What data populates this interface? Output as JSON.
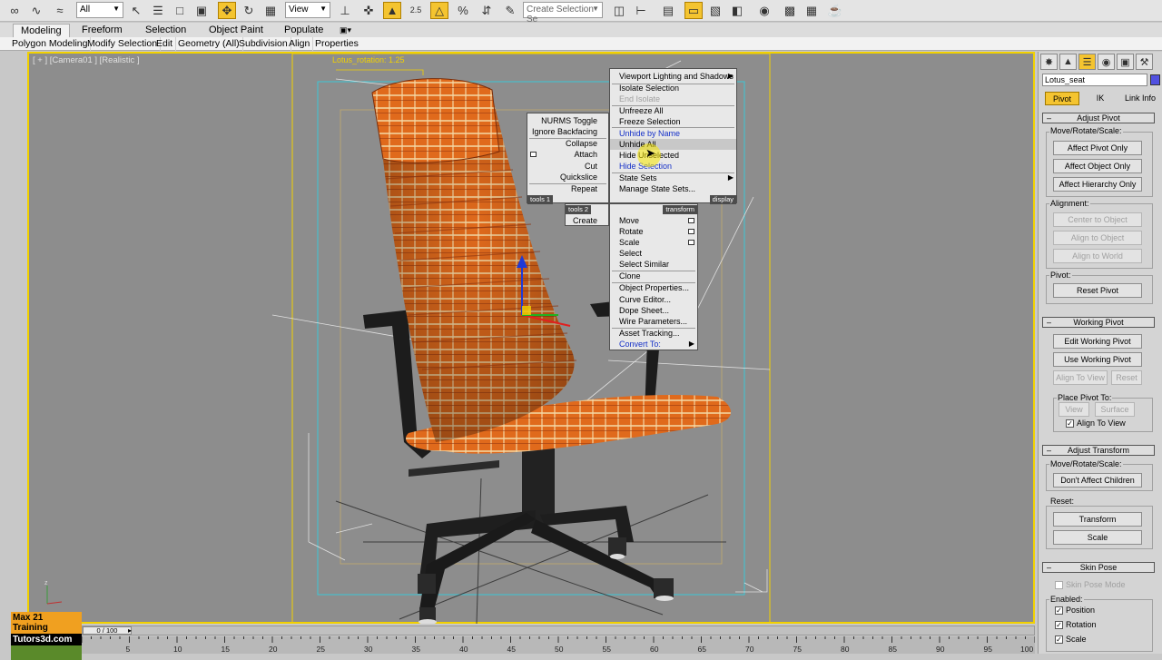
{
  "toolbar": {
    "selection_filter": "All",
    "coordinate_system": "View",
    "selection_set_placeholder": "Create Selection Se",
    "percent_label": "2.5"
  },
  "ribbon": {
    "tabs": [
      "Modeling",
      "Freeform",
      "Selection",
      "Object Paint",
      "Populate"
    ],
    "subtabs": [
      "Polygon Modeling",
      "Modify Selection",
      "Edit",
      "Geometry (All)",
      "Subdivision",
      "Align",
      "Properties"
    ]
  },
  "viewport": {
    "label": "[ + ] [Camera01 ] [Realistic ]",
    "annotation": "Lotus_rotation: 1.25",
    "accent_color": "#f2d100"
  },
  "quad_menu": {
    "display": {
      "title": "display",
      "items": [
        {
          "label": "Viewport Lighting and Shadows",
          "state": "submenu"
        },
        {
          "label": "Isolate Selection",
          "state": "normal"
        },
        {
          "label": "End Isolate",
          "state": "disabled"
        },
        {
          "label": "Unfreeze All",
          "state": "normal"
        },
        {
          "label": "Freeze Selection",
          "state": "normal"
        },
        {
          "label": "Unhide by Name",
          "state": "blue"
        },
        {
          "label": "Unhide All",
          "state": "highlight"
        },
        {
          "label": "Hide Unselected",
          "state": "normal"
        },
        {
          "label": "Hide Selection",
          "state": "blue"
        },
        {
          "label": "State Sets",
          "state": "submenu"
        },
        {
          "label": "Manage State Sets...",
          "state": "normal"
        }
      ]
    },
    "tools1": {
      "title": "tools 1",
      "items": [
        "NURMS Toggle",
        "Ignore Backfacing",
        "Collapse",
        "Attach",
        "Cut",
        "Quickslice",
        "Repeat"
      ]
    },
    "tools2": {
      "title": "tools 2",
      "items": [
        "Create"
      ]
    },
    "transform": {
      "title": "transform",
      "items": [
        {
          "label": "Move",
          "state": "box"
        },
        {
          "label": "Rotate",
          "state": "box"
        },
        {
          "label": "Scale",
          "state": "box"
        },
        {
          "label": "Select",
          "state": "normal"
        },
        {
          "label": "Select Similar",
          "state": "normal"
        },
        {
          "label": "Clone",
          "state": "normal"
        },
        {
          "label": "Object Properties...",
          "state": "normal"
        },
        {
          "label": "Curve Editor...",
          "state": "normal"
        },
        {
          "label": "Dope Sheet...",
          "state": "normal"
        },
        {
          "label": "Wire Parameters...",
          "state": "normal"
        },
        {
          "label": "Asset Tracking...",
          "state": "normal"
        },
        {
          "label": "Convert To:",
          "state": "blue-submenu"
        }
      ]
    }
  },
  "panel": {
    "object_name": "Lotus_seat",
    "object_color": "#5050e0",
    "subtabs": [
      "Pivot",
      "IK",
      "Link Info"
    ],
    "adjust_pivot": {
      "title": "Adjust Pivot",
      "move_label": "Move/Rotate/Scale:",
      "buttons": [
        "Affect Pivot Only",
        "Affect Object Only",
        "Affect Hierarchy Only"
      ],
      "alignment_label": "Alignment:",
      "align_buttons": [
        "Center to Object",
        "Align to Object",
        "Align to World"
      ],
      "pivot_label": "Pivot:",
      "reset_pivot": "Reset Pivot"
    },
    "working_pivot": {
      "title": "Working Pivot",
      "edit": "Edit Working Pivot",
      "use": "Use Working Pivot",
      "align_to_view": "Align To View",
      "reset": "Reset",
      "place_label": "Place Pivot To:",
      "view": "View",
      "surface": "Surface",
      "align_check": "Align To View"
    },
    "adjust_transform": {
      "title": "Adjust Transform",
      "move_label": "Move/Rotate/Scale:",
      "dont_affect": "Don't Affect Children",
      "reset_label": "Reset:",
      "transform": "Transform",
      "scale": "Scale"
    },
    "skin_pose": {
      "title": "Skin Pose",
      "mode": "Skin Pose Mode",
      "enabled_label": "Enabled:",
      "position": "Position",
      "rotation": "Rotation",
      "scale": "Scale"
    }
  },
  "timeline": {
    "frame_display": "0 / 100",
    "ticks": [
      "5",
      "10",
      "15",
      "20",
      "25",
      "30",
      "35",
      "40",
      "45",
      "50",
      "55",
      "60",
      "65",
      "70",
      "75",
      "80",
      "85",
      "90",
      "95",
      "100"
    ]
  },
  "logo": {
    "line1": "Max 21 Training",
    "line2": "Tutors3d.com"
  }
}
